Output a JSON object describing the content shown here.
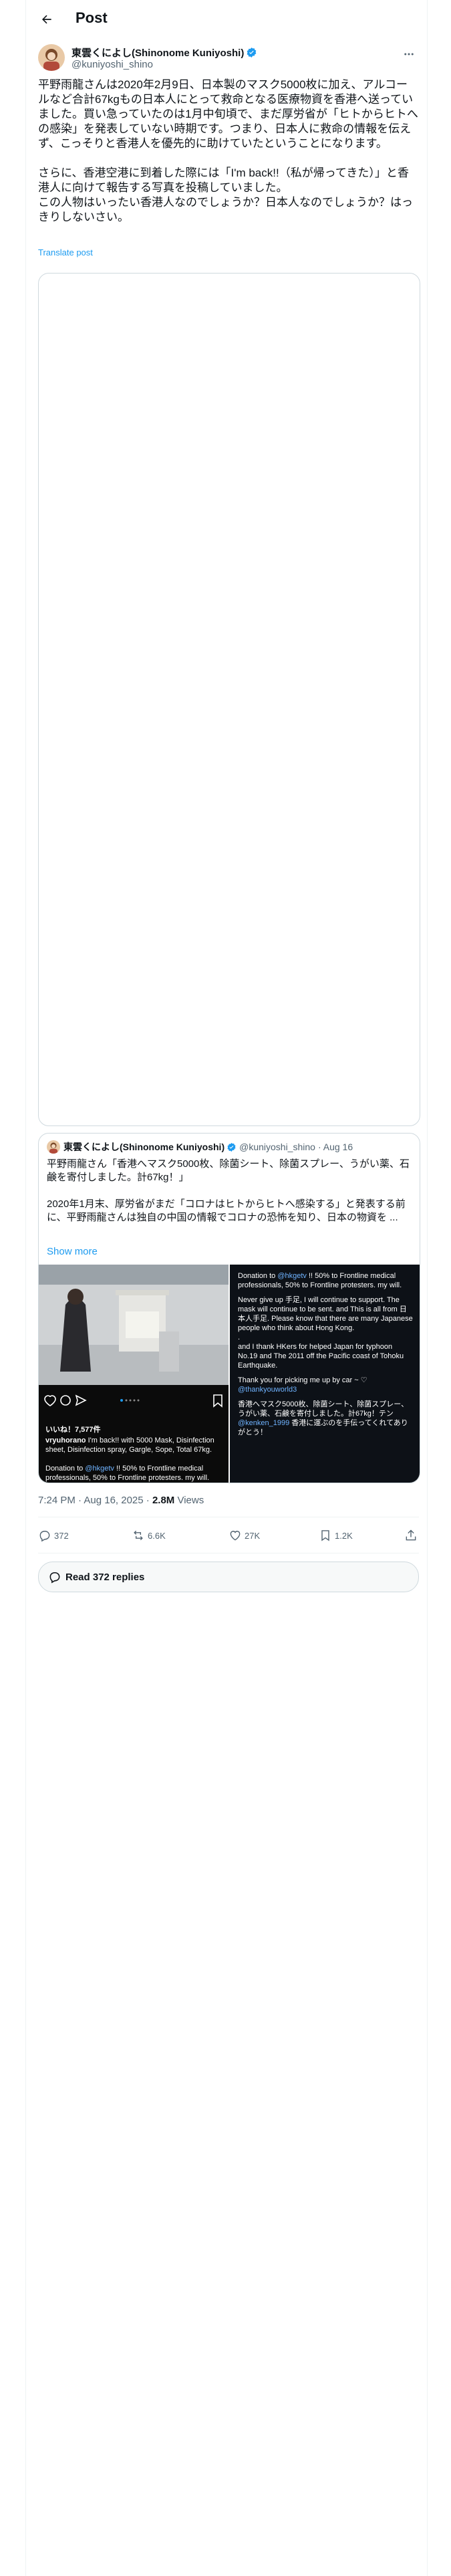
{
  "header": {
    "title": "Post"
  },
  "author": {
    "name": "東雲くによし(Shinonome Kuniyoshi)",
    "handle": "@kuniyoshi_shino"
  },
  "post": {
    "text": "平野雨龍さんは2020年2月9日、日本製のマスク5000枚に加え、アルコールなど合計67kgもの日本人にとって救命となる医療物資を香港へ送っていました。買い急っていたのは1月中旬頃で、まだ厚労省が「ヒトからヒトへの感染」を発表していない時期です。つまり、日本人に救命の情報を伝えず、こっそりと香港人を優先的に助けていたということになります。\n\nさらに、香港空港に到着した際には「I'm back!!（私が帰ってきた）」と香港人に向けて報告する写真を投稿していました。\nこの人物はいったい香港人なのでしょうか？日本人なのでしょうか？はっきりしないさい。",
    "translate_label": "Translate post",
    "timestamp": "7:24 PM · Aug 16, 2025 ·",
    "views_count": "2.8M",
    "views_label": "Views"
  },
  "quote": {
    "name": "東雲くによし(Shinonome Kuniyoshi)",
    "handle": "@kuniyoshi_shino",
    "date": "· Aug 16",
    "text": "平野雨龍さん「香港へマスク5000枚、除菌シート、除菌スプレー、うがい薬、石鹸を寄付しました。計67kg！」\n\n2020年1月末、厚労省がまだ「コロナはヒトからヒトへ感染する」と発表する前に、平野雨龍さんは独自の中国の情報でコロナの恐怖を知り、日本の物資を ...",
    "show_more": "Show more",
    "instagram": {
      "likes": "いいね！7,577件",
      "user": "vryuhorano",
      "caption": "I'm back!! with 5000 Mask, Disinfection sheet, Disinfection spray, Gargle, Sope, Total 67kg.",
      "donation_prefix": "Donation to ",
      "donation_handle": "@hkgetv",
      "donation_suffix": " !! 50% to Frontline medical professionals, 50% to Frontline protesters. my will."
    },
    "repost_text": {
      "p1_prefix": "Donation to ",
      "p1_handle": "@hkgetv",
      "p1_suffix": " !! 50% to Frontline medical professionals, 50% to Frontline protesters. my will.",
      "p2": "Never give up 手足, I will continue to support. The mask will continue to be sent. and This is all from 日本人手足. Please know that there are many Japanese people who think about Hong Kong.\n.\nand I thank HKers for helped Japan for typhoon No.19 and The 2011 off the Pacific coast of Tohoku Earthquake.",
      "p3_prefix": "Thank you for picking me up by car ~ ♡ ",
      "p3_handle": "@thankyouworld3",
      "p4_prefix": "香港へマスク5000枚、除菌シート、除菌スプレー、うがい薬、石鹸を寄付しました。計67kg！テン",
      "p4_handle": "@kenken_1999",
      "p4_suffix": " 香港に運ぶのを手伝ってくれてありがとう！"
    }
  },
  "actions": {
    "replies": "372",
    "reposts": "6.6K",
    "likes": "27K",
    "bookmarks": "1.2K"
  },
  "read_replies": {
    "label": "Read 372 replies"
  },
  "colors": {
    "accent": "#1d9bf0",
    "muted": "#536471",
    "border": "#cfd9de"
  }
}
